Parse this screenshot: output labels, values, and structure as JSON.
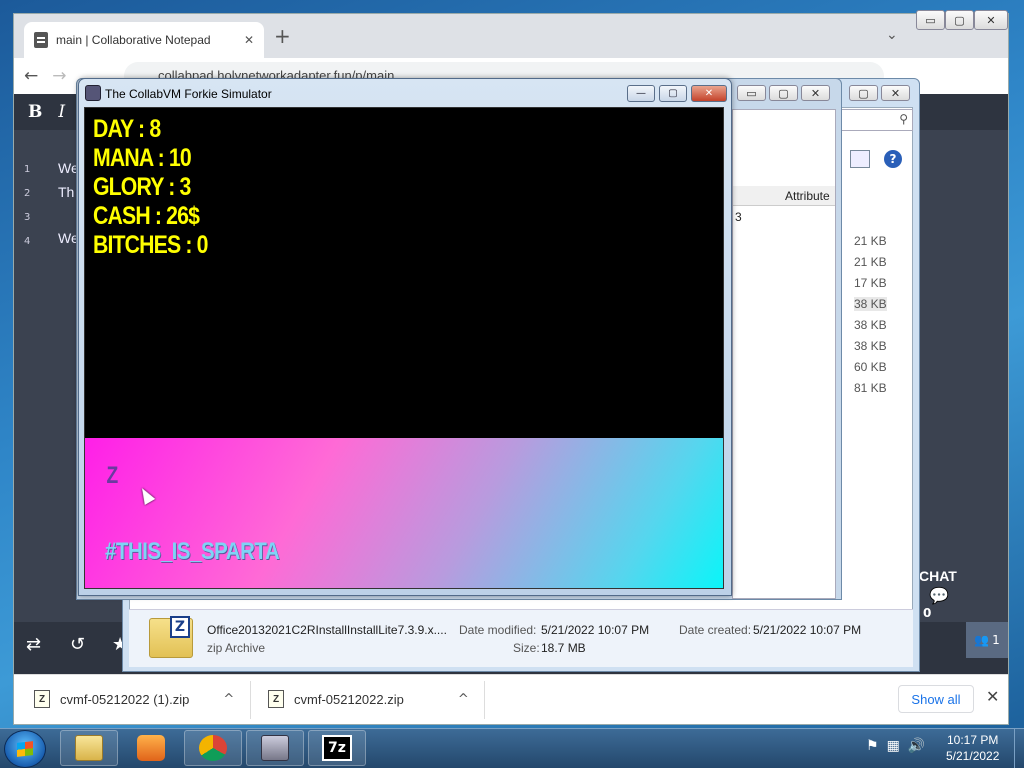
{
  "browser": {
    "tab_title": "main | Collaborative Notepad",
    "tab_close": "✕",
    "new_tab": "+",
    "tab_search": "⌄",
    "url": "collabpad.holynetworkadapter.fun/p/main",
    "nav": {
      "back": "←",
      "forward": "→",
      "share": "⇗",
      "star": "☆",
      "sidebar": "▣",
      "profile": "●",
      "menu": "⋮"
    },
    "window_buttons": {
      "minimize": "▭",
      "maximize": "▢",
      "close": "✕"
    }
  },
  "notepad": {
    "format_bold": "B",
    "format_italic": "I",
    "lines": [
      {
        "num": "1",
        "text": "We"
      },
      {
        "num": "2",
        "text": "Th"
      },
      {
        "num": "3",
        "text": ""
      },
      {
        "num": "4",
        "text": "We"
      }
    ],
    "chat_label": "CHAT",
    "chat_icon": "💬",
    "chat_count": "0",
    "users_count": "1",
    "bottom_icons": {
      "swap": "⇄",
      "history": "↺",
      "star": "★"
    }
  },
  "downloads": {
    "items": [
      {
        "name": "cvmf-05212022 (1).zip",
        "icon": "Z"
      },
      {
        "name": "cvmf-05212022.zip",
        "icon": "Z"
      }
    ],
    "chevron": "^",
    "show_all": "Show all",
    "close": "✕"
  },
  "explorer": {
    "column_attributes": "Attribute",
    "sizes": [
      "21 KB",
      "21 KB",
      "17 KB",
      "38 KB",
      "38 KB",
      "38 KB",
      "60 KB",
      "81 KB"
    ],
    "row_fragment": "3",
    "help": "?",
    "search_icon": "⚲",
    "file_name": "Office20132021C2RInstallInstallLite7.3.9.x....",
    "file_type": "zip Archive",
    "date_modified_label": "Date modified:",
    "date_modified": "5/21/2022 10:07 PM",
    "date_created_label": "Date created:",
    "date_created": "5/21/2022 10:07 PM",
    "size_label": "Size:",
    "size": "18.7 MB",
    "zip_badge": "Z"
  },
  "simulator": {
    "title": "The CollabVM Forkie Simulator",
    "stats": [
      "DAY : 8",
      "MANA : 10",
      "GLORY : 3",
      "CASH : 26$",
      "BITCHES : 0"
    ],
    "key_hint": "Z",
    "slogan": "#THIS_IS_SPARTA",
    "buttons": {
      "minimize": "—",
      "maximize": "▢",
      "close": "✕"
    }
  },
  "taskbar": {
    "time": "10:17 PM",
    "date": "5/21/2022",
    "sevenzip_label": "7z",
    "tray": [
      "⚑",
      "▦",
      "🔊"
    ]
  },
  "colors": {
    "stat_yellow": "#ffff00",
    "accent_link": "#1a73e8",
    "page_bg": "#3b4250"
  }
}
